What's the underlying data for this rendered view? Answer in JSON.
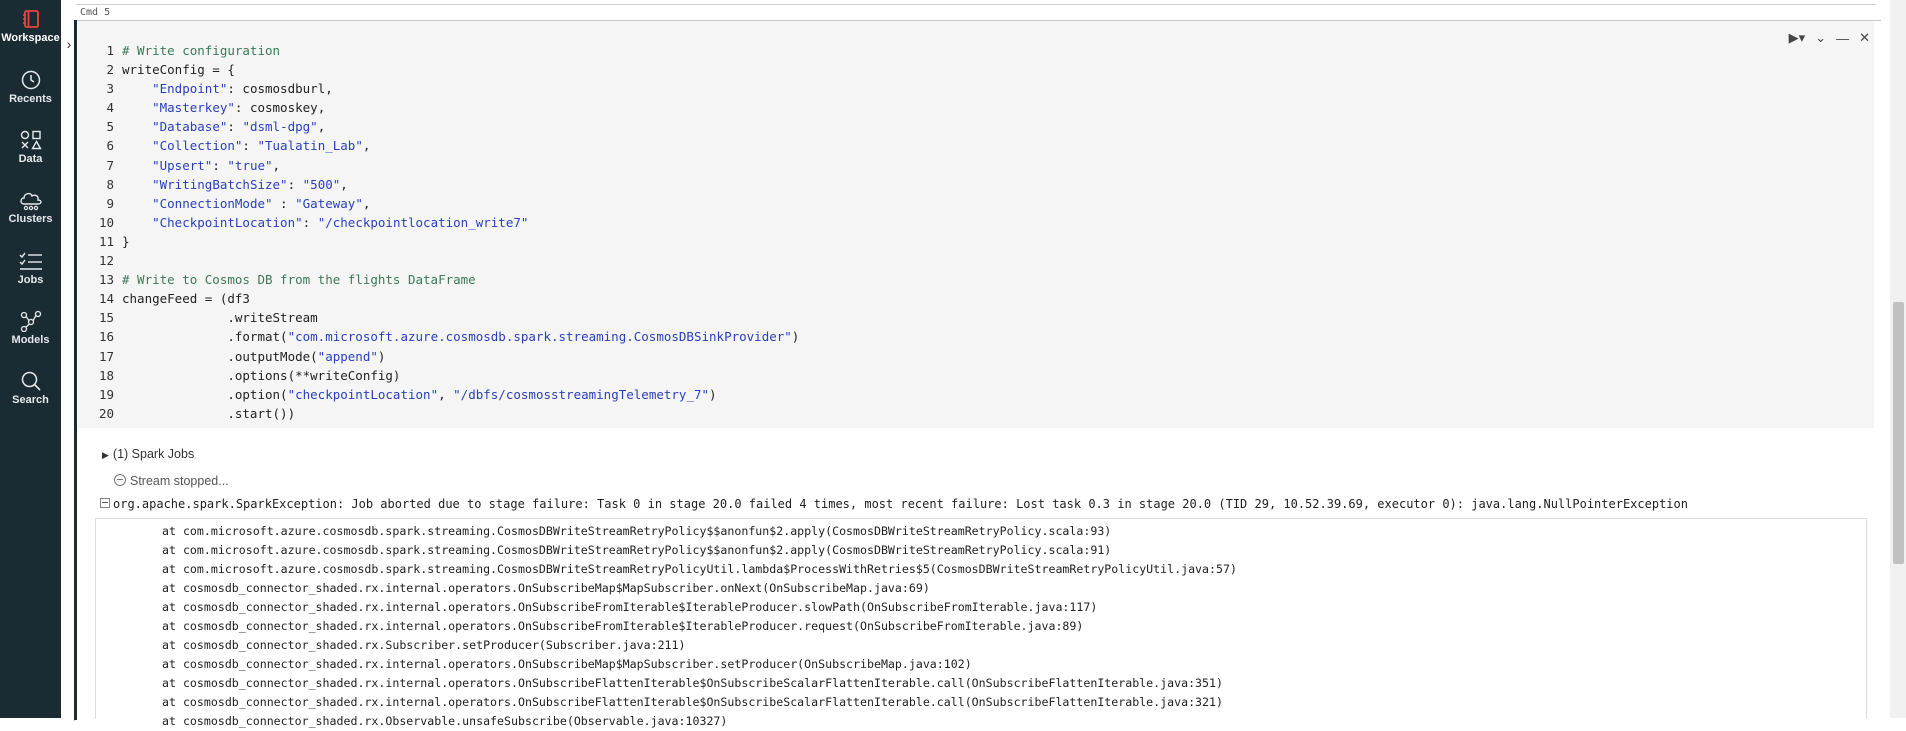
{
  "sidebar": {
    "items": [
      {
        "label": "Workspace",
        "icon": "workspace-icon"
      },
      {
        "label": "Recents",
        "icon": "clock-icon"
      },
      {
        "label": "Data",
        "icon": "shapes-icon"
      },
      {
        "label": "Clusters",
        "icon": "cloud-icon"
      },
      {
        "label": "Jobs",
        "icon": "checklist-icon"
      },
      {
        "label": "Models",
        "icon": "models-icon"
      },
      {
        "label": "Search",
        "icon": "search-icon"
      }
    ],
    "active_color": "#e8453c"
  },
  "cell": {
    "cmd_label": "Cmd 5",
    "code_lines": [
      {
        "n": "1",
        "parts": [
          {
            "t": "# Write configuration",
            "c": "cm"
          }
        ]
      },
      {
        "n": "2",
        "parts": [
          {
            "t": "writeConfig = {",
            "c": "tx"
          }
        ]
      },
      {
        "n": "3",
        "parts": [
          {
            "t": "    ",
            "c": "tx"
          },
          {
            "t": "\"Endpoint\"",
            "c": "st"
          },
          {
            "t": ": cosmosdburl,",
            "c": "tx"
          }
        ]
      },
      {
        "n": "4",
        "parts": [
          {
            "t": "    ",
            "c": "tx"
          },
          {
            "t": "\"Masterkey\"",
            "c": "st"
          },
          {
            "t": ": cosmoskey,",
            "c": "tx"
          }
        ]
      },
      {
        "n": "5",
        "parts": [
          {
            "t": "    ",
            "c": "tx"
          },
          {
            "t": "\"Database\"",
            "c": "st"
          },
          {
            "t": ": ",
            "c": "tx"
          },
          {
            "t": "\"dsml-dpg\"",
            "c": "st"
          },
          {
            "t": ",",
            "c": "tx"
          }
        ]
      },
      {
        "n": "6",
        "parts": [
          {
            "t": "    ",
            "c": "tx"
          },
          {
            "t": "\"Collection\"",
            "c": "st"
          },
          {
            "t": ": ",
            "c": "tx"
          },
          {
            "t": "\"Tualatin_Lab\"",
            "c": "st"
          },
          {
            "t": ",",
            "c": "tx"
          }
        ]
      },
      {
        "n": "7",
        "parts": [
          {
            "t": "    ",
            "c": "tx"
          },
          {
            "t": "\"Upsert\"",
            "c": "st"
          },
          {
            "t": ": ",
            "c": "tx"
          },
          {
            "t": "\"true\"",
            "c": "st"
          },
          {
            "t": ",",
            "c": "tx"
          }
        ]
      },
      {
        "n": "8",
        "parts": [
          {
            "t": "    ",
            "c": "tx"
          },
          {
            "t": "\"WritingBatchSize\"",
            "c": "st"
          },
          {
            "t": ": ",
            "c": "tx"
          },
          {
            "t": "\"500\"",
            "c": "st"
          },
          {
            "t": ",",
            "c": "tx"
          }
        ]
      },
      {
        "n": "9",
        "parts": [
          {
            "t": "    ",
            "c": "tx"
          },
          {
            "t": "\"ConnectionMode\"",
            "c": "st"
          },
          {
            "t": " : ",
            "c": "tx"
          },
          {
            "t": "\"Gateway\"",
            "c": "st"
          },
          {
            "t": ",",
            "c": "tx"
          }
        ]
      },
      {
        "n": "10",
        "parts": [
          {
            "t": "    ",
            "c": "tx"
          },
          {
            "t": "\"CheckpointLocation\"",
            "c": "st"
          },
          {
            "t": ": ",
            "c": "tx"
          },
          {
            "t": "\"/checkpointlocation_write7\"",
            "c": "st"
          }
        ]
      },
      {
        "n": "11",
        "parts": [
          {
            "t": "}",
            "c": "tx"
          }
        ]
      },
      {
        "n": "12",
        "parts": [
          {
            "t": "",
            "c": "tx"
          }
        ]
      },
      {
        "n": "13",
        "parts": [
          {
            "t": "# Write to Cosmos DB from the flights DataFrame",
            "c": "cm"
          }
        ]
      },
      {
        "n": "14",
        "parts": [
          {
            "t": "changeFeed = (df3",
            "c": "tx"
          }
        ]
      },
      {
        "n": "15",
        "parts": [
          {
            "t": "              .writeStream",
            "c": "tx"
          }
        ]
      },
      {
        "n": "16",
        "parts": [
          {
            "t": "              .format(",
            "c": "tx"
          },
          {
            "t": "\"com.microsoft.azure.cosmosdb.spark.streaming.CosmosDBSinkProvider\"",
            "c": "st"
          },
          {
            "t": ")",
            "c": "tx"
          }
        ]
      },
      {
        "n": "17",
        "parts": [
          {
            "t": "              .outputMode(",
            "c": "tx"
          },
          {
            "t": "\"append\"",
            "c": "st"
          },
          {
            "t": ")",
            "c": "tx"
          }
        ]
      },
      {
        "n": "18",
        "parts": [
          {
            "t": "              .options(**writeConfig)",
            "c": "tx"
          }
        ]
      },
      {
        "n": "19",
        "parts": [
          {
            "t": "              .option(",
            "c": "tx"
          },
          {
            "t": "\"checkpointLocation\"",
            "c": "st"
          },
          {
            "t": ", ",
            "c": "tx"
          },
          {
            "t": "\"/dbfs/cosmosstreamingTelemetry_7\"",
            "c": "st"
          },
          {
            "t": ")",
            "c": "tx"
          }
        ]
      },
      {
        "n": "20",
        "parts": [
          {
            "t": "              .start())",
            "c": "tx"
          }
        ]
      }
    ]
  },
  "output": {
    "spark_jobs": "(1) Spark Jobs",
    "stream_status": "Stream stopped...",
    "error_header": "org.apache.spark.SparkException: Job aborted due to stage failure: Task 0 in stage 20.0 failed 4 times, most recent failure: Lost task 0.3 in stage 20.0 (TID 29, 10.52.39.69, executor 0): java.lang.NullPointerException",
    "trace_lines": [
      "at com.microsoft.azure.cosmosdb.spark.streaming.CosmosDBWriteStreamRetryPolicy$$anonfun$2.apply(CosmosDBWriteStreamRetryPolicy.scala:93)",
      "at com.microsoft.azure.cosmosdb.spark.streaming.CosmosDBWriteStreamRetryPolicy$$anonfun$2.apply(CosmosDBWriteStreamRetryPolicy.scala:91)",
      "at com.microsoft.azure.cosmosdb.spark.streaming.CosmosDBWriteStreamRetryPolicyUtil.lambda$ProcessWithRetries$5(CosmosDBWriteStreamRetryPolicyUtil.java:57)",
      "at cosmosdb_connector_shaded.rx.internal.operators.OnSubscribeMap$MapSubscriber.onNext(OnSubscribeMap.java:69)",
      "at cosmosdb_connector_shaded.rx.internal.operators.OnSubscribeFromIterable$IterableProducer.slowPath(OnSubscribeFromIterable.java:117)",
      "at cosmosdb_connector_shaded.rx.internal.operators.OnSubscribeFromIterable$IterableProducer.request(OnSubscribeFromIterable.java:89)",
      "at cosmosdb_connector_shaded.rx.Subscriber.setProducer(Subscriber.java:211)",
      "at cosmosdb_connector_shaded.rx.internal.operators.OnSubscribeMap$MapSubscriber.setProducer(OnSubscribeMap.java:102)",
      "at cosmosdb_connector_shaded.rx.internal.operators.OnSubscribeFlattenIterable$OnSubscribeScalarFlattenIterable.call(OnSubscribeFlattenIterable.java:351)",
      "at cosmosdb_connector_shaded.rx.internal.operators.OnSubscribeFlattenIterable$OnSubscribeScalarFlattenIterable.call(OnSubscribeFlattenIterable.java:321)",
      "at cosmosdb_connector_shaded.rx.Observable.unsafeSubscribe(Observable.java:10327)"
    ]
  }
}
